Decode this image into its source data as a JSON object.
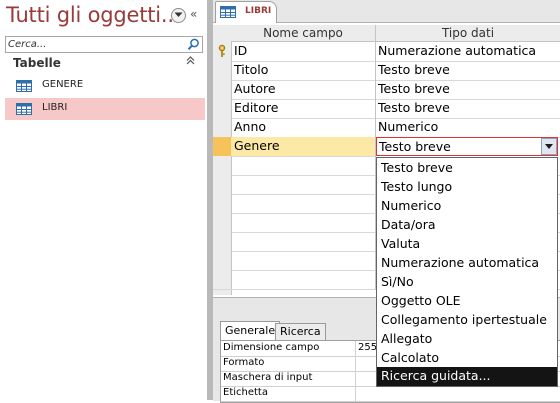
{
  "nav": {
    "title": "Tutti gli oggetti...",
    "collapse_glyph": "«",
    "search_placeholder": "Cerca...",
    "group_label": "Tabelle",
    "group_collapse_glyph": "⌃",
    "items": [
      {
        "label": "GENERE",
        "icon": "table-icon",
        "selected": false
      },
      {
        "label": "LIBRI",
        "icon": "table-icon",
        "selected": true
      }
    ]
  },
  "document_tab": {
    "label": "LIBRI",
    "icon": "table-icon"
  },
  "grid": {
    "headers": {
      "name": "Nome campo",
      "type": "Tipo dati"
    },
    "rows": [
      {
        "name": "ID",
        "type": "Numerazione automatica",
        "primary_key": true
      },
      {
        "name": "Titolo",
        "type": "Testo breve"
      },
      {
        "name": "Autore",
        "type": "Testo breve"
      },
      {
        "name": "Editore",
        "type": "Testo breve"
      },
      {
        "name": "Anno",
        "type": "Numerico"
      },
      {
        "name": "Genere",
        "type": "Testo breve",
        "current": true
      }
    ]
  },
  "dropdown": {
    "options": [
      "Testo breve",
      "Testo lungo",
      "Numerico",
      "Data/ora",
      "Valuta",
      "Numerazione automatica",
      "Sì/No",
      "Oggetto OLE",
      "Collegamento ipertestuale",
      "Allegato",
      "Calcolato",
      "Ricerca guidata..."
    ],
    "highlighted": "Ricerca guidata..."
  },
  "properties": {
    "tabs": [
      "Generale",
      "Ricerca"
    ],
    "active_tab": "Generale",
    "rows": [
      {
        "name": "Dimensione campo",
        "value": "255"
      },
      {
        "name": "Formato",
        "value": ""
      },
      {
        "name": "Maschera di input",
        "value": ""
      },
      {
        "name": "Etichetta",
        "value": ""
      }
    ]
  },
  "colors": {
    "nav_title": "#9a3a3a",
    "selected_nav_item": "#f7c8c8",
    "current_row_selector": "#f5c35a",
    "dropdown_highlight": "#141414"
  }
}
